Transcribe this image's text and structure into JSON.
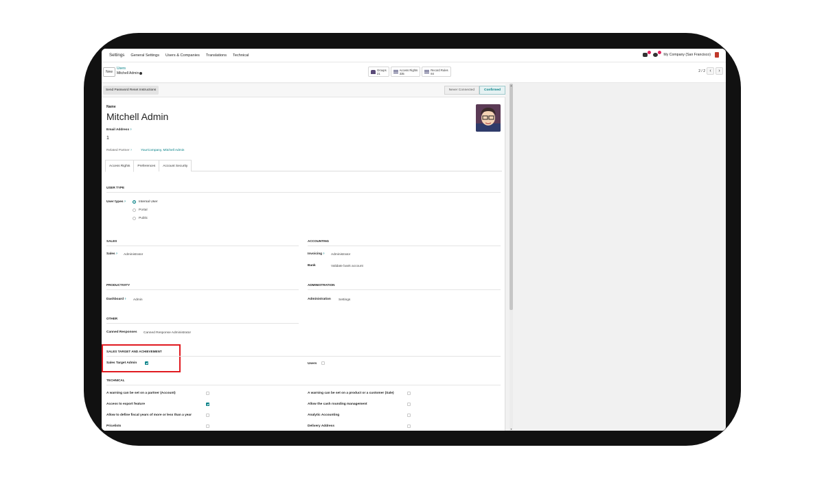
{
  "nav": {
    "app": "Settings",
    "items": [
      "General Settings",
      "Users & Companies",
      "Translations",
      "Technical"
    ],
    "company": "My Company (San Francisco)"
  },
  "control": {
    "new_label": "New",
    "breadcrumb_parent": "Users",
    "breadcrumb_current": "Mitchell Admin",
    "stats": [
      {
        "label": "Groups",
        "count": "21",
        "icon": "groups-icon"
      },
      {
        "label": "Access Rights",
        "count": "335",
        "icon": "list-icon"
      },
      {
        "label": "Record Rules",
        "count": "84",
        "icon": "list-icon"
      }
    ],
    "pager": "2 / 2"
  },
  "status": {
    "reset_button": "Send Password Reset Instructions",
    "stages": [
      "Never Connected",
      "Confirmed"
    ],
    "active_stage": "Confirmed"
  },
  "form": {
    "name_label": "Name",
    "name": "Mitchell Admin",
    "email_label": "Email Address",
    "email_sup": "?",
    "email": "1",
    "related_partner_label": "Related Partner",
    "related_partner_sup": "?",
    "related_partner": "YourCompany, Mitchell Admin",
    "tabs": [
      "Access Rights",
      "Preferences",
      "Account Security"
    ],
    "active_tab": "Access Rights"
  },
  "access": {
    "user_type": {
      "title": "USER TYPE",
      "label": "User types",
      "sup": "?",
      "options": [
        "Internal User",
        "Portal",
        "Public"
      ],
      "selected": "Internal User"
    },
    "sales": {
      "title": "SALES",
      "label": "Sales",
      "sup": "?",
      "value": "Administrator"
    },
    "accounting": {
      "title": "ACCOUNTING",
      "invoicing_label": "Invoicing",
      "invoicing_sup": "?",
      "invoicing_value": "Administrator",
      "bank_label": "Bank",
      "bank_value": "Validate bank account"
    },
    "productivity": {
      "title": "PRODUCTIVITY",
      "label": "Dashboard",
      "sup": "?",
      "value": "Admin"
    },
    "administration": {
      "title": "ADMINISTRATION",
      "label": "Administration",
      "value": "Settings"
    },
    "other": {
      "title": "OTHER",
      "label": "Canned Responses",
      "value": "Canned Response Administrator"
    },
    "sales_target": {
      "title": "SALES TARGET AND ACHIEVEMENT",
      "label": "Sales Target Admin",
      "checked": true,
      "users_label": "Users",
      "users_checked": false
    },
    "technical": {
      "title": "TECHNICAL",
      "left": [
        {
          "label": "A warning can be set on a partner (Account)",
          "checked": false
        },
        {
          "label": "Access to export feature",
          "checked": true
        },
        {
          "label": "Allow to define fiscal years of more or less than a year",
          "checked": false
        },
        {
          "label": "Pricelists",
          "checked": false
        }
      ],
      "right": [
        {
          "label": "A warning can be set on a product or a customer (Sale)",
          "checked": false
        },
        {
          "label": "Allow the cash rounding management",
          "checked": false
        },
        {
          "label": "Analytic Accounting",
          "checked": false
        },
        {
          "label": "Delivery Address",
          "checked": false
        }
      ]
    }
  },
  "colors": {
    "accent": "#017e84",
    "highlight": "#e0191f",
    "frame": "#111111"
  }
}
